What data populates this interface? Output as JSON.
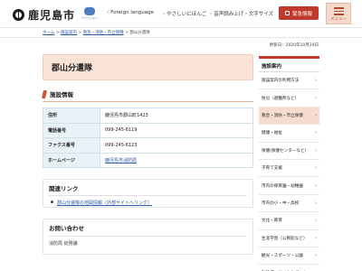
{
  "header": {
    "site_name": "鹿児島市",
    "mascot_caption": "サクラジマン",
    "nav": [
      {
        "label": "Foreign language"
      },
      {
        "label": "やさしいにほんご"
      },
      {
        "label": "音声読み上げ・文字サイズ"
      }
    ],
    "emergency_label": "緊急情報",
    "menu_label": "メニュー"
  },
  "breadcrumb": {
    "items": [
      "ホーム",
      "施設案内",
      "救急・消防・市立保健",
      "郡山分遣隊"
    ],
    "separator": " > "
  },
  "updated": "更新日：2020年10月20日",
  "page": {
    "title": "郡山分遣隊",
    "section_title": "施設情報",
    "info": [
      {
        "key": "住所",
        "value": "鹿児島市郡山町1423",
        "link": false
      },
      {
        "key": "電話番号",
        "value": "099-245-6119",
        "link": false
      },
      {
        "key": "ファクス番号",
        "value": "099-245-6123",
        "link": false
      },
      {
        "key": "ホームページ",
        "value": "鹿児島市消防局",
        "link": true
      }
    ],
    "related_title": "関連リンク",
    "related_links": [
      {
        "label": "郡山分遣隊の地図情報（外部サイトへリンク）"
      }
    ],
    "contact_title": "お問い合わせ",
    "contact_sub": "消防局 総務課"
  },
  "sidebar": {
    "title": "施設案内",
    "items": [
      {
        "label": "施設案内の利用方法",
        "active": false
      },
      {
        "label": "防災（避難所など）",
        "active": false
      },
      {
        "label": "救急・消防・市立保健",
        "active": true
      },
      {
        "label": "健康・福祉",
        "active": false
      },
      {
        "label": "保健(保健センターなど)",
        "active": false
      },
      {
        "label": "子育て支援",
        "active": false
      },
      {
        "label": "市内の保育園・幼稚園",
        "active": false
      },
      {
        "label": "市内の小・中・高校",
        "active": false
      },
      {
        "label": "文化・教育",
        "active": false
      },
      {
        "label": "生涯学習（公民館など）",
        "active": false
      },
      {
        "label": "観光・スポーツ・公園",
        "active": false
      },
      {
        "label": "駐輪場・サイクルポート",
        "active": false
      }
    ]
  }
}
